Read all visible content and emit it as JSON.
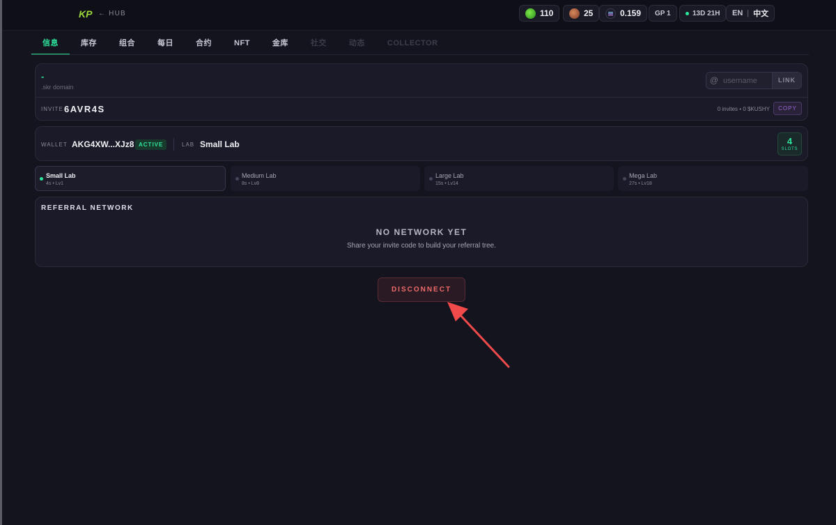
{
  "header": {
    "hub_link": "← HUB",
    "stats": {
      "green_count": "110",
      "brown_count": "25",
      "token_value": "0.159",
      "gp": "GP 1",
      "timer": "13D 21H",
      "lang_en": "EN",
      "lang_cn": "中文"
    }
  },
  "tabs": [
    {
      "label": "信息",
      "state": "active"
    },
    {
      "label": "库存",
      "state": "normal"
    },
    {
      "label": "组合",
      "state": "normal"
    },
    {
      "label": "每日",
      "state": "normal"
    },
    {
      "label": "合约",
      "state": "normal"
    },
    {
      "label": "NFT",
      "state": "normal"
    },
    {
      "label": "金库",
      "state": "normal"
    },
    {
      "label": "社交",
      "state": "disabled"
    },
    {
      "label": "动态",
      "state": "disabled"
    },
    {
      "label": "COLLECTOR",
      "state": "disabled"
    }
  ],
  "domain": {
    "value": "-",
    "label": ".skr domain",
    "username_placeholder": "username",
    "link_label": "LINK",
    "invite_label": "INVITE",
    "invite_code": "6AVR4S",
    "invites_count": "0 invites",
    "kushy": "0 $KUSHY",
    "copy_label": "COPY"
  },
  "wallet": {
    "label": "WALLET",
    "address": "AKG4XW...XJz8",
    "status": "ACTIVE",
    "lab_label": "LAB",
    "lab_value": "Small Lab",
    "slots_value": "4",
    "slots_label": "SLOTS"
  },
  "labs": [
    {
      "name": "Small Lab",
      "time": "4s",
      "level": "Lv1",
      "selected": true
    },
    {
      "name": "Medium Lab",
      "time": "8s",
      "level": "Lv8",
      "selected": false
    },
    {
      "name": "Large Lab",
      "time": "15s",
      "level": "Lv14",
      "selected": false
    },
    {
      "name": "Mega Lab",
      "time": "27s",
      "level": "Lv18",
      "selected": false
    }
  ],
  "referral": {
    "title": "REFERRAL NETWORK",
    "empty_title": "NO NETWORK YET",
    "empty_sub": "Share your invite code to build your referral tree."
  },
  "disconnect_label": "DISCONNECT",
  "colors": {
    "accent": "#2ee59d",
    "danger": "#f06a6a",
    "annotation_arrow": "#f04a4a"
  }
}
